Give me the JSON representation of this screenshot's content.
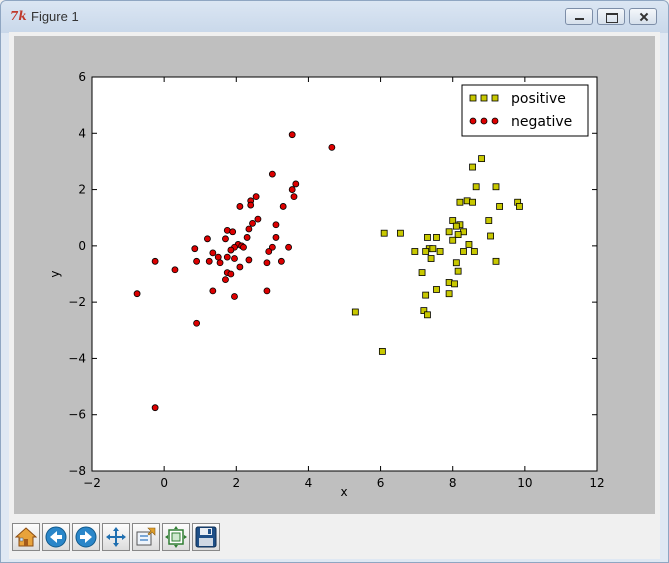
{
  "window": {
    "title": "Figure 1",
    "app_icon_glyph": "7k",
    "controls": [
      {
        "name": "minimize-icon"
      },
      {
        "name": "maximize-icon"
      },
      {
        "name": "close-icon"
      }
    ]
  },
  "toolbar": {
    "buttons": [
      {
        "name": "home-button",
        "icon": "home-icon"
      },
      {
        "name": "back-button",
        "icon": "arrow-left-icon"
      },
      {
        "name": "forward-button",
        "icon": "arrow-right-icon"
      },
      {
        "name": "pan-button",
        "icon": "move-arrows-icon"
      },
      {
        "name": "zoom-button",
        "icon": "zoom-rect-icon"
      },
      {
        "name": "subplots-button",
        "icon": "subplots-config-icon"
      },
      {
        "name": "save-button",
        "icon": "floppy-disk-icon"
      }
    ]
  },
  "chart_data": {
    "type": "scatter",
    "xlabel": "x",
    "ylabel": "y",
    "xlim": [
      -2,
      12
    ],
    "ylim": [
      -8,
      6
    ],
    "xticks": [
      -2,
      0,
      2,
      4,
      6,
      8,
      10,
      12
    ],
    "yticks": [
      -8,
      -6,
      -4,
      -2,
      0,
      2,
      4,
      6
    ],
    "grid": false,
    "legend_position": "top-right",
    "series": [
      {
        "name": "positive",
        "marker": "square",
        "color": "#c8c800",
        "points": [
          [
            8.8,
            3.1
          ],
          [
            8.55,
            2.8
          ],
          [
            8.65,
            2.1
          ],
          [
            9.2,
            2.1
          ],
          [
            8.4,
            1.6
          ],
          [
            8.55,
            1.55
          ],
          [
            8.2,
            1.55
          ],
          [
            9.8,
            1.55
          ],
          [
            9.85,
            1.4
          ],
          [
            9.3,
            1.4
          ],
          [
            8.0,
            0.9
          ],
          [
            8.2,
            0.75
          ],
          [
            8.1,
            0.7
          ],
          [
            9.0,
            0.9
          ],
          [
            7.9,
            0.5
          ],
          [
            8.3,
            0.5
          ],
          [
            8.15,
            0.4
          ],
          [
            6.1,
            0.45
          ],
          [
            6.55,
            0.45
          ],
          [
            7.3,
            0.3
          ],
          [
            7.55,
            0.3
          ],
          [
            8.0,
            0.2
          ],
          [
            9.05,
            0.35
          ],
          [
            8.45,
            0.05
          ],
          [
            7.35,
            -0.1
          ],
          [
            7.25,
            -0.2
          ],
          [
            7.45,
            -0.1
          ],
          [
            6.95,
            -0.2
          ],
          [
            7.65,
            -0.2
          ],
          [
            8.3,
            -0.2
          ],
          [
            8.6,
            -0.2
          ],
          [
            7.4,
            -0.45
          ],
          [
            8.1,
            -0.6
          ],
          [
            9.2,
            -0.55
          ],
          [
            7.15,
            -0.95
          ],
          [
            8.15,
            -0.9
          ],
          [
            7.9,
            -1.3
          ],
          [
            8.05,
            -1.35
          ],
          [
            7.55,
            -1.55
          ],
          [
            7.25,
            -1.75
          ],
          [
            7.9,
            -1.7
          ],
          [
            7.2,
            -2.3
          ],
          [
            7.3,
            -2.45
          ],
          [
            5.3,
            -2.35
          ],
          [
            6.05,
            -3.75
          ]
        ]
      },
      {
        "name": "negative",
        "marker": "circle",
        "color": "#dd0000",
        "points": [
          [
            3.55,
            3.95
          ],
          [
            4.65,
            3.5
          ],
          [
            3.0,
            2.55
          ],
          [
            3.65,
            2.2
          ],
          [
            3.55,
            2.0
          ],
          [
            3.6,
            1.75
          ],
          [
            2.55,
            1.75
          ],
          [
            2.4,
            1.6
          ],
          [
            2.4,
            1.45
          ],
          [
            2.1,
            1.4
          ],
          [
            3.3,
            1.4
          ],
          [
            2.6,
            0.95
          ],
          [
            2.45,
            0.8
          ],
          [
            3.1,
            0.75
          ],
          [
            2.35,
            0.6
          ],
          [
            1.75,
            0.55
          ],
          [
            1.9,
            0.5
          ],
          [
            1.2,
            0.25
          ],
          [
            1.7,
            0.25
          ],
          [
            2.3,
            0.3
          ],
          [
            3.1,
            0.3
          ],
          [
            2.05,
            0.05
          ],
          [
            2.15,
            0.0
          ],
          [
            2.2,
            -0.05
          ],
          [
            1.95,
            -0.05
          ],
          [
            3.45,
            -0.05
          ],
          [
            3.0,
            -0.05
          ],
          [
            0.85,
            -0.1
          ],
          [
            1.85,
            -0.15
          ],
          [
            2.9,
            -0.2
          ],
          [
            1.35,
            -0.25
          ],
          [
            1.5,
            -0.4
          ],
          [
            1.75,
            -0.4
          ],
          [
            2.35,
            -0.5
          ],
          [
            1.95,
            -0.45
          ],
          [
            -0.25,
            -0.55
          ],
          [
            0.9,
            -0.55
          ],
          [
            1.25,
            -0.55
          ],
          [
            1.55,
            -0.6
          ],
          [
            3.25,
            -0.55
          ],
          [
            2.85,
            -0.6
          ],
          [
            2.1,
            -0.75
          ],
          [
            0.3,
            -0.85
          ],
          [
            1.75,
            -0.95
          ],
          [
            1.85,
            -1.0
          ],
          [
            1.7,
            -1.2
          ],
          [
            1.35,
            -1.6
          ],
          [
            2.85,
            -1.6
          ],
          [
            -0.75,
            -1.7
          ],
          [
            1.95,
            -1.8
          ],
          [
            0.9,
            -2.75
          ],
          [
            -0.25,
            -5.75
          ]
        ]
      }
    ]
  }
}
